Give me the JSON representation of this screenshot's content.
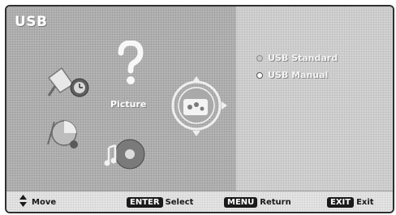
{
  "menu": {
    "title": "USB",
    "selected_label": "Picture",
    "options": [
      {
        "label": "USB Standard",
        "state": "inactive"
      },
      {
        "label": "USB Manual",
        "state": "active"
      }
    ]
  },
  "footer": {
    "move_label": "Move",
    "enter_key": "ENTER",
    "enter_label": "Select",
    "menu_key": "MENU",
    "menu_label": "Return",
    "exit_key": "EXIT",
    "exit_label": "Exit"
  },
  "icons": [
    "satellite-icon",
    "help-icon",
    "photo-icon",
    "music-icon",
    "movie-icon",
    "picture-selector-icon",
    "up-down-arrow-icon"
  ],
  "colors": {
    "left_panel": "#b4b4b4",
    "right_panel": "#d2d2d2",
    "footer": "#e4e4e4",
    "frame": "#2f2f2f"
  }
}
